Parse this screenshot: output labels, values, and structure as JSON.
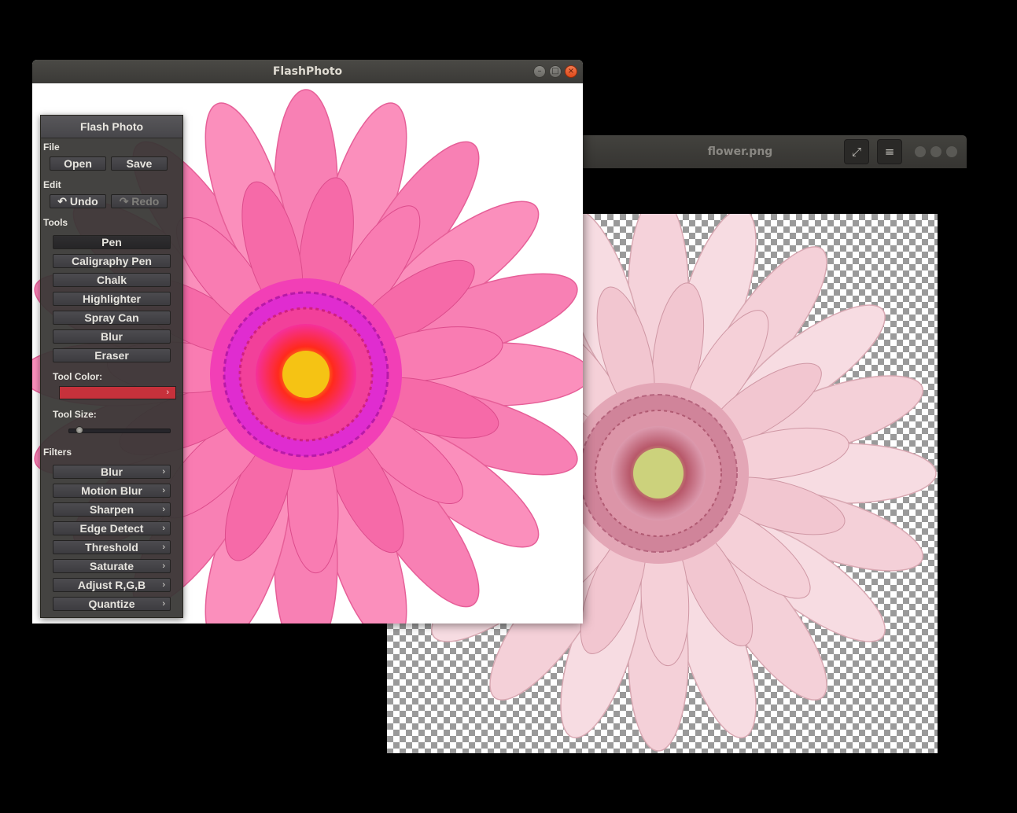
{
  "viewer": {
    "title": "flower.png",
    "fullscreen_icon": "⤢",
    "menu_icon": "≡"
  },
  "flashphoto": {
    "title": "FlashPhoto",
    "panel": {
      "header": "Flash Photo",
      "file_label": "File",
      "open": "Open",
      "save": "Save",
      "edit_label": "Edit",
      "undo": "↶ Undo",
      "redo": "↷ Redo",
      "tools_label": "Tools",
      "tools": [
        "Pen",
        "Caligraphy Pen",
        "Chalk",
        "Highlighter",
        "Spray Can",
        "Blur",
        "Eraser"
      ],
      "tool_color_label": "Tool Color:",
      "tool_color": "#c6313b",
      "tool_size_label": "Tool Size:",
      "tool_size": 0.08,
      "filters_label": "Filters",
      "filters": [
        "Blur",
        "Motion Blur",
        "Sharpen",
        "Edge Detect",
        "Threshold",
        "Saturate",
        "Adjust R,G,B",
        "Quantize"
      ]
    }
  }
}
